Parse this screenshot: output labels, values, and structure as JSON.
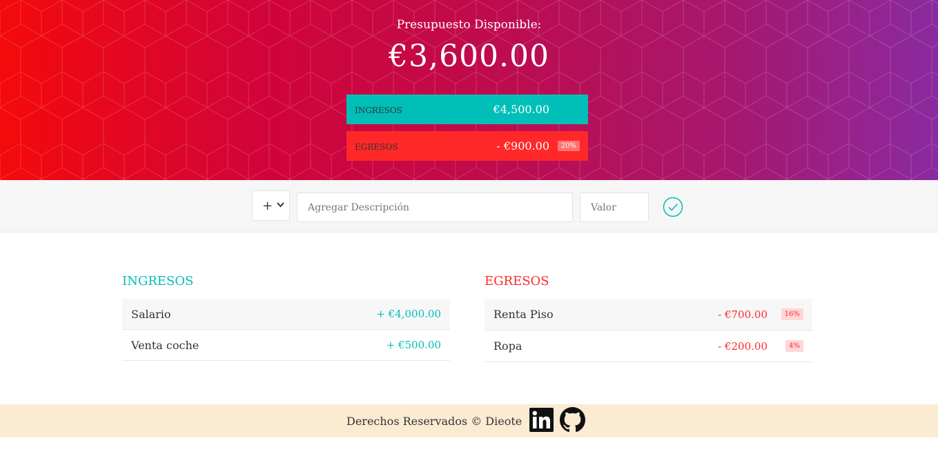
{
  "header": {
    "title": "Presupuesto Disponible:",
    "amount": "€3,600.00",
    "income": {
      "label": "INGRESOS",
      "value": "€4,500.00"
    },
    "expense": {
      "label": "EGRESOS",
      "value": "- €900.00",
      "percentage": "20%"
    }
  },
  "add_bar": {
    "type_selected": "+",
    "description_placeholder": "Agregar Descripción",
    "value_placeholder": "Valor"
  },
  "income_list": {
    "title": "INGRESOS",
    "items": [
      {
        "description": "Salario",
        "value": "+ €4,000.00"
      },
      {
        "description": "Venta coche",
        "value": "+ €500.00"
      }
    ]
  },
  "expense_list": {
    "title": "EGRESOS",
    "items": [
      {
        "description": "Renta Piso",
        "value": "- €700.00",
        "percentage": "16%"
      },
      {
        "description": "Ropa",
        "value": "- €200.00",
        "percentage": "4%"
      }
    ]
  },
  "footer": {
    "text": "Derechos Reservados © Dieote",
    "icons": [
      "linkedin-icon",
      "github-icon"
    ]
  },
  "colors": {
    "income": "#00bfb8",
    "expense": "#ff2828",
    "footer_bg": "#fbebd3"
  }
}
